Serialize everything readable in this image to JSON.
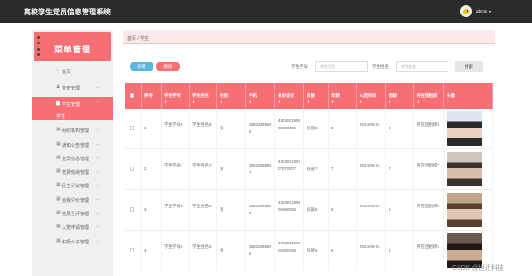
{
  "header": {
    "app_title": "高校学生党员信息管理系统",
    "username": "admin",
    "user_menu_icon": "chevron-down-icon"
  },
  "sidebar": {
    "banner": "菜单管理",
    "items": [
      {
        "label": "首页",
        "icon": "home-icon",
        "active": false
      },
      {
        "label": "党史管理",
        "icon": "user-icon",
        "active": false
      },
      {
        "label": "学生管理",
        "icon": "users-icon",
        "active": true
      },
      {
        "label": "学生",
        "icon": "",
        "active": true,
        "sub": true
      },
      {
        "label": "组织机构管理",
        "icon": "grid-icon",
        "active": false
      },
      {
        "label": "通知公告管理",
        "icon": "grid-icon",
        "active": false
      },
      {
        "label": "党员信息管理",
        "icon": "grid-icon",
        "active": false
      },
      {
        "label": "党费缴纳管理",
        "icon": "grid-icon",
        "active": false
      },
      {
        "label": "民主评议管理",
        "icon": "grid-icon",
        "active": false
      },
      {
        "label": "自我评价管理",
        "icon": "grid-icon",
        "active": false
      },
      {
        "label": "党员互评管理",
        "icon": "grid-icon",
        "active": false
      },
      {
        "label": "入党申请管理",
        "icon": "grid-icon",
        "active": false
      },
      {
        "label": "积极分子管理",
        "icon": "grid-icon",
        "active": false
      }
    ]
  },
  "breadcrumb": "首页 / 学生",
  "toolbar": {
    "add_label": "新增",
    "delete_label": "删除",
    "student_no_label": "学生学号",
    "student_no_placeholder": "学生学号",
    "student_name_label": "学生姓名",
    "student_name_placeholder": "学生姓名",
    "search_label": "搜索"
  },
  "table": {
    "columns": [
      "",
      "序号",
      "学生学号",
      "学生姓名",
      "性别",
      "手机",
      "身份证号",
      "民族",
      "年龄",
      "入团时间",
      "团龄",
      "所在团组织",
      "头像"
    ],
    "sortable": [
      false,
      false,
      true,
      true,
      true,
      true,
      true,
      true,
      true,
      true,
      true,
      true,
      true
    ],
    "rows": [
      {
        "index": "1",
        "student_no": "学生学号8",
        "student_name": "学生姓名8",
        "gender": "男",
        "phone": "13823888888",
        "id_card": "440300199808080008",
        "ethnicity": "民族8",
        "age": "8",
        "join_date": "2024-05-01",
        "league_age": "8",
        "org": "所在团组织8",
        "photo_colors": [
          "#dde6ee",
          "#2a2a2a",
          "#e9d2c4"
        ]
      },
      {
        "index": "2",
        "student_no": "学生学号7",
        "student_name": "学生姓名7",
        "gender": "男",
        "phone": "13823888887",
        "id_card": "440300199707070007",
        "ethnicity": "民族7",
        "age": "7",
        "join_date": "2024-05-01",
        "league_age": "7",
        "org": "所在团组织7",
        "photo_colors": [
          "#cfc7be",
          "#3a3330",
          "#d9c0ae"
        ]
      },
      {
        "index": "3",
        "student_no": "学生学号6",
        "student_name": "学生姓名6",
        "gender": "男",
        "phone": "13823888886",
        "id_card": "440300199606060006",
        "ethnicity": "民族6",
        "age": "6",
        "join_date": "2024-05-01",
        "league_age": "6",
        "org": "所在团组织6",
        "photo_colors": [
          "#bfa58a",
          "#5a4030",
          "#e0c7b3"
        ]
      },
      {
        "index": "4",
        "student_no": "学生学号5",
        "student_name": "学生姓名5",
        "gender": "男",
        "phone": "13823888885",
        "id_card": "440300199505050005",
        "ethnicity": "民族5",
        "age": "5",
        "join_date": "2024-05-01",
        "league_age": "5",
        "org": "所在团组织5",
        "photo_colors": [
          "#6b5a52",
          "#1f1a18",
          "#c9ab96"
        ]
      }
    ]
  },
  "watermark": "CSDN @世迁科技"
}
